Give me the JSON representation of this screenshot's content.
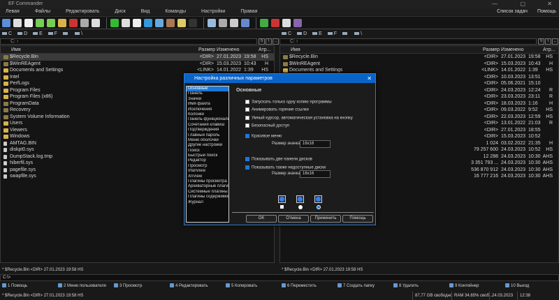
{
  "app": {
    "title": "EF Commander",
    "window_controls": [
      "—",
      "▢",
      "✕"
    ]
  },
  "menu": [
    "Левая",
    "Файлы",
    "Редактировать",
    "Диск",
    "Вид",
    "Команды",
    "Настройки",
    "Правая"
  ],
  "menu_right": [
    "Список задач",
    "Помощь"
  ],
  "toolbar_icons": [
    "new-window",
    "view",
    "edit",
    "copy",
    "move",
    "new-folder",
    "delete",
    "print",
    "mail",
    "refresh",
    "find",
    "split",
    "sync",
    "compare",
    "archive",
    "search-file",
    "console",
    "properties",
    "network",
    "recycle-bin",
    "monitor",
    "connect",
    "disconnect",
    "info",
    "media"
  ],
  "toolbar_colors": [
    "#5a8fd8",
    "#ddd",
    "#eee",
    "#7c5",
    "#7c5",
    "#d9b24a",
    "#c33",
    "#aaa",
    "#ddd",
    "#3b3",
    "#ddd",
    "#eee",
    "#39d",
    "#6ad",
    "#a75",
    "#dc6",
    "#333",
    "#9bd",
    "#aaa",
    "#ccc",
    "#68c",
    "#4a4",
    "#c33",
    "#ddd",
    "#86a"
  ],
  "drives": [
    "C",
    "D",
    "E",
    "F",
    "",
    "\\"
  ],
  "left": {
    "path": "C: ›",
    "nav": [
      "\\\\",
      "\\",
      ".."
    ]
  },
  "right": {
    "path": "C: ›",
    "nav": [
      "\\\\",
      "\\",
      ".."
    ]
  },
  "columns": {
    "name": "Имя",
    "size": "Размер",
    "modified": "Изменено",
    "attr": "Атр..."
  },
  "files": [
    {
      "name": "$Recycle.Bin",
      "size": "<DIR>",
      "date": "27.01.2023",
      "time": "19:58",
      "attr": "HS",
      "type": "dim"
    },
    {
      "name": "$WinREAgent",
      "size": "<DIR>",
      "date": "15.03.2023",
      "time": "10:43",
      "attr": "H",
      "type": "dim"
    },
    {
      "name": "Documents and Settings",
      "size": "<LINK>",
      "date": "14.01.2022",
      "time": "1:39",
      "attr": "HS",
      "type": "link"
    },
    {
      "name": "Intel",
      "size": "<DIR>",
      "date": "10.03.2023",
      "time": "13:51",
      "attr": "",
      "type": "dir"
    },
    {
      "name": "PerfLogs",
      "size": "<DIR>",
      "date": "05.06.2021",
      "time": "15:10",
      "attr": "",
      "type": "dir"
    },
    {
      "name": "Program Files",
      "size": "<DIR>",
      "date": "24.03.2023",
      "time": "12:24",
      "attr": "R",
      "type": "dir"
    },
    {
      "name": "Program Files (x86)",
      "size": "<DIR>",
      "date": "23.03.2023",
      "time": "23:11",
      "attr": "R",
      "type": "dir"
    },
    {
      "name": "ProgramData",
      "size": "<DIR>",
      "date": "18.03.2023",
      "time": "1:16",
      "attr": "H",
      "type": "dim"
    },
    {
      "name": "Recovery",
      "size": "<DIR>",
      "date": "09.03.2022",
      "time": "9:52",
      "attr": "HS",
      "type": "dim"
    },
    {
      "name": "System Volume Information",
      "size": "<DIR>",
      "date": "22.03.2023",
      "time": "12:59",
      "attr": "HS",
      "type": "dim"
    },
    {
      "name": "Users",
      "size": "<DIR>",
      "date": "13.01.2022",
      "time": "21:03",
      "attr": "R",
      "type": "dir"
    },
    {
      "name": "Viewers",
      "size": "<DIR>",
      "date": "27.01.2023",
      "time": "18:55",
      "attr": "",
      "type": "dir"
    },
    {
      "name": "Windows",
      "size": "<DIR>",
      "date": "15.03.2023",
      "time": "10:52",
      "attr": "",
      "type": "dir"
    },
    {
      "name": "AMTAG.BIN",
      "size": "1 024",
      "date": "03.02.2022",
      "time": "21:35",
      "attr": "H",
      "type": "file"
    },
    {
      "name": "diskpt0.sys",
      "size": "79 257 600",
      "date": "24.03.2023",
      "time": "10:52",
      "attr": "HS",
      "type": "file"
    },
    {
      "name": "DumpStack.log.tmp",
      "size": "12 288",
      "date": "24.03.2023",
      "time": "10:30",
      "attr": "AHS",
      "type": "file"
    },
    {
      "name": "hiberfil.sys",
      "size": "3 351 793 ...",
      "date": "24.03.2023",
      "time": "10:30",
      "attr": "AHS",
      "type": "file"
    },
    {
      "name": "pagefile.sys",
      "size": "536 870 912",
      "date": "24.03.2023",
      "time": "10:30",
      "attr": "AHS",
      "type": "file"
    },
    {
      "name": "swapfile.sys",
      "size": "16 777 216",
      "date": "24.03.2023",
      "time": "10:30",
      "attr": "AHS",
      "type": "file"
    }
  ],
  "left_status": "* $Recycle.Bin   <DIR>  27.01.2023  19:58  HS",
  "right_status": "* $Recycle.Bin   <DIR>  27.01.2023  19:58  HS",
  "command_line": "C:\\>",
  "fkeys": [
    "1 Помощь",
    "2 Меню пользователя",
    "3 Просмотр",
    "4 Редактировать",
    "5 Копировать",
    "6 Переместить",
    "7 Создать папку",
    "8 Удалить",
    "9 Контейнер",
    "10 Выход"
  ],
  "bottom": {
    "status": "* $Recycle.Bin   <DIR>  27.01.2023  19:58  HS",
    "free": "87,77 GB свободно",
    "ram": "RAM 34,65% своб...",
    "date": "24.03.2023",
    "time": "12:38"
  },
  "dialog": {
    "title": "Настройка различных параметров",
    "categories": [
      "Основные",
      "Панель",
      "Значки",
      "Имя файла",
      "Исключения",
      "Колонки",
      "Панель функциональных",
      "Сочетания клавиш",
      "Подтверждения",
      "Главный пароль",
      "Меню оболочки",
      "Другие настройки",
      "Поиск",
      "Быстрый поиск",
      "Редактор",
      "Просмотр",
      "IrfanView",
      "XnView",
      "Плагины просмотра",
      "Архиваторные плагины",
      "Системные плагины",
      "Плагины содержимого",
      "Журнал"
    ],
    "selected_category": "Основные",
    "heading": "Основные",
    "options": [
      {
        "label": "Запускать только одну копию программы",
        "checked": false
      },
      {
        "label": "Анимировать горячие ссылки",
        "checked": false
      },
      {
        "label": "Умный курсор, автоматическая установка на кнопку",
        "checked": false
      },
      {
        "label": "Безопасный доступ",
        "checked": false
      },
      {
        "label": "Красивое меню",
        "checked": true
      },
      {
        "label": "Показывать две панели дисков",
        "checked": true
      },
      {
        "label": "Показывать также недоступные диски",
        "checked": true
      }
    ],
    "icon_size_label": "Размер значка",
    "icon_size_1": "16x16",
    "icon_size_2": "16x16",
    "style_selected": 3,
    "buttons": {
      "ok": "OK",
      "cancel": "Отмена",
      "apply": "Применить",
      "help": "Помощь"
    },
    "accent": "#0a64c8"
  }
}
